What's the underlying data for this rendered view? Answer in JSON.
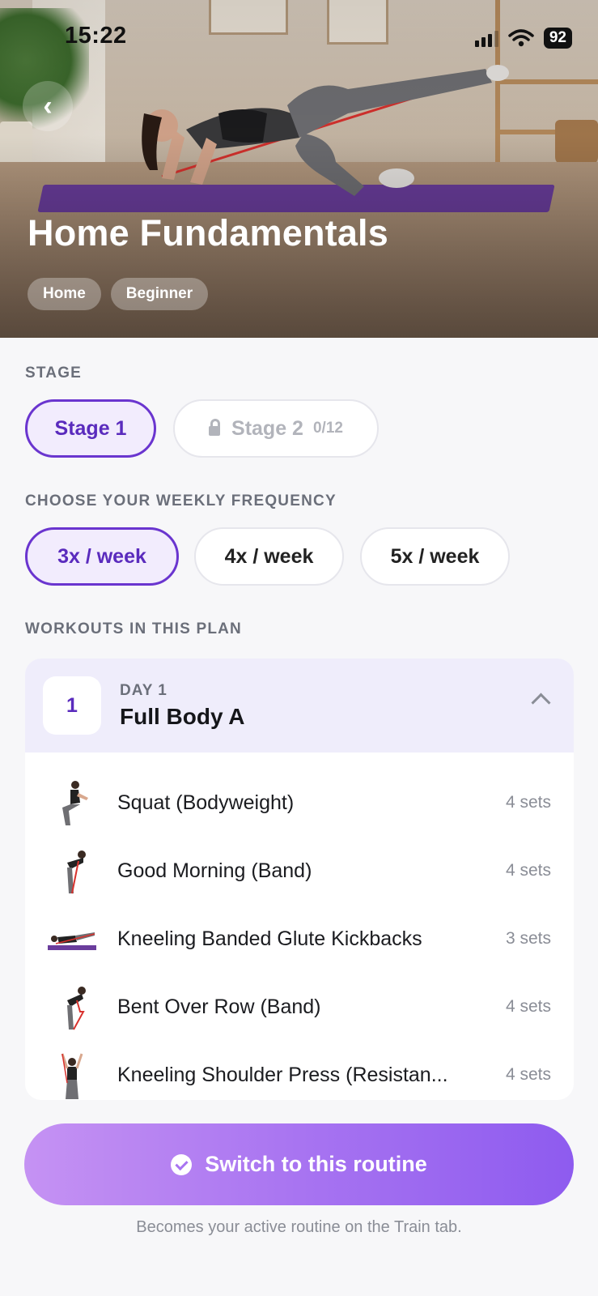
{
  "status_bar": {
    "time": "15:22",
    "battery": "92",
    "icons": [
      "cellular-signal-icon",
      "wifi-icon",
      "battery-icon"
    ]
  },
  "hero": {
    "title": "Home Fundamentals",
    "tags": [
      "Home",
      "Beginner"
    ],
    "back_icon": "chevron-left-icon"
  },
  "stage": {
    "label": "STAGE",
    "options": [
      {
        "label": "Stage 1",
        "selected": true,
        "locked": false,
        "progress": ""
      },
      {
        "label": "Stage 2",
        "selected": false,
        "locked": true,
        "progress": "0/12"
      }
    ]
  },
  "frequency": {
    "label": "CHOOSE YOUR WEEKLY FREQUENCY",
    "options": [
      {
        "label": "3x / week",
        "selected": true
      },
      {
        "label": "4x / week",
        "selected": false
      },
      {
        "label": "5x / week",
        "selected": false
      }
    ]
  },
  "workouts": {
    "label": "WORKOUTS IN THIS PLAN",
    "day": {
      "number": "1",
      "label": "DAY 1",
      "title": "Full Body A",
      "expanded": true,
      "exercises": [
        {
          "name": "Squat (Bodyweight)",
          "sets": "4 sets"
        },
        {
          "name": "Good Morning (Band)",
          "sets": "4 sets"
        },
        {
          "name": "Kneeling Banded Glute Kickbacks",
          "sets": "3 sets"
        },
        {
          "name": "Bent Over Row (Band)",
          "sets": "4 sets"
        },
        {
          "name": "Kneeling Shoulder Press (Resistan...",
          "sets": "4 sets"
        }
      ]
    }
  },
  "cta": {
    "label": "Switch to this routine",
    "note": "Becomes your active routine on the Train tab."
  },
  "colors": {
    "accent": "#6a35cf",
    "accent_bg": "#f2ecfd",
    "cta_start": "#c592f3",
    "cta_end": "#8e5bef"
  }
}
